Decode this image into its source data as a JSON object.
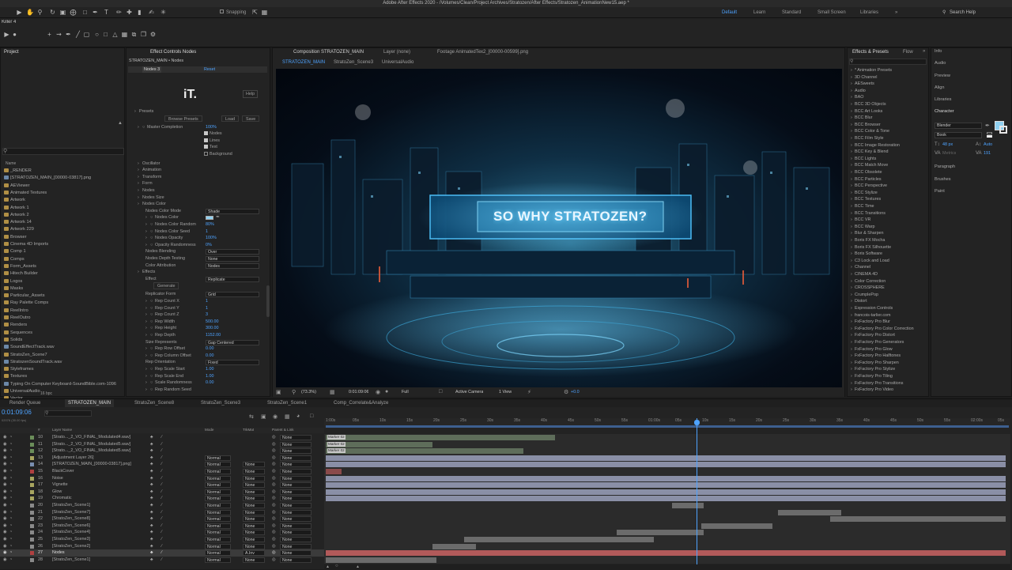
{
  "app": {
    "title": "Adobe After Effects 2020 - /Volumes/Clean/Project Archives/Stratozen/After Effects/Stratozen_AnimationNew15.aep *"
  },
  "toolbar": {
    "snapping_label": "Snapping",
    "workspaces": [
      "Default",
      "Learn",
      "Standard",
      "Small Screen",
      "Libraries"
    ],
    "active_workspace": "Default",
    "search_placeholder": "Search Help",
    "tool_preset": "Killer 4"
  },
  "project": {
    "title": "Project",
    "column_name": "Name",
    "items": [
      "_RENDER",
      "[STRATOZEN_MAIN_[00000-03817].png",
      "AEViewer",
      "Animated Textures",
      "Artwork",
      "Artwork 1",
      "Artwork 2",
      "Artwork 14",
      "Artwork 229",
      "Browser",
      "Cinema 4D Imports",
      "Comp 1",
      "Comps",
      "Form_Assets",
      "Hitech Builder",
      "Logos",
      "Masks",
      "Particular_Assets",
      "Ray Palette Comps",
      "ReelIntro",
      "ReelOutro",
      "Renders",
      "Sequences",
      "Solids",
      "SoundEffectTrack.wav",
      "StratoZen_Scene7",
      "StratozenSoundTrack.wav",
      "Styleframes",
      "Textures",
      "Typing On Computer Keyboard-SoundBible.com-1096",
      "UniversalAudio",
      "Vector",
      "VoiceOver",
      "Stratozen..._2_VO_FINAL_Modulated5.wav",
      "WorldMap.obj"
    ],
    "footer_bpc": "16 bpc"
  },
  "effect_controls": {
    "tab_label": "Effect Controls Nodes",
    "subtitle": "STRATOZEN_MAIN • Nodes",
    "effect_name": "Nodes 3",
    "reset_label": "Reset",
    "logo_text": "iT.",
    "help_label": "Help",
    "presets_label": "Presets",
    "browse_presets": "Browse Presets",
    "load_label": "Load",
    "save_label": "Save",
    "master_completion_label": "Master Completion",
    "master_completion_value": "100%",
    "checkboxes": [
      "Nodes",
      "Lines",
      "Text",
      "Background"
    ],
    "groups": [
      "Oscillator",
      "Animation",
      "Transform",
      "Form",
      "Nodes",
      "Nodes Size",
      "Nodes Color"
    ],
    "nodes_color_props": [
      {
        "label": "Nodes Color Mode",
        "value": "Shade",
        "dropdown": true
      },
      {
        "label": "Nodes Color",
        "value": "",
        "dropdown": false
      },
      {
        "label": "Nodes Color Random",
        "value": "80%",
        "dropdown": false
      },
      {
        "label": "Nodes Color Seed",
        "value": "1",
        "dropdown": false
      },
      {
        "label": "Nodes Opacity",
        "value": "100%",
        "dropdown": false
      },
      {
        "label": "Opacity Randomness",
        "value": "0%",
        "dropdown": false
      },
      {
        "label": "Nodes Blending",
        "value": "Over",
        "dropdown": true
      },
      {
        "label": "Nodes Depth Testing",
        "value": "None",
        "dropdown": true
      },
      {
        "label": "Color Attribution",
        "value": "Nodes",
        "dropdown": true
      }
    ],
    "effects_label": "Effects",
    "effect_label": "Effect",
    "effect_value": "Replicate",
    "generate_label": "Generate",
    "replicator_props": [
      {
        "label": "Replicator Form",
        "value": "Grid",
        "dropdown": true
      },
      {
        "label": "Rep Count X",
        "value": "1",
        "dropdown": false
      },
      {
        "label": "Rep Count Y",
        "value": "1",
        "dropdown": false
      },
      {
        "label": "Rep Count Z",
        "value": "3",
        "dropdown": false
      },
      {
        "label": "Rep Width",
        "value": "500.00",
        "dropdown": false
      },
      {
        "label": "Rep Height",
        "value": "300.00",
        "dropdown": false
      },
      {
        "label": "Rep Depth",
        "value": "1152.00",
        "dropdown": false
      },
      {
        "label": "Size Represents",
        "value": "Gap Centered",
        "dropdown": true
      },
      {
        "label": "Rep Row Offset",
        "value": "0.00",
        "dropdown": false
      },
      {
        "label": "Rep Column Offset",
        "value": "0.00",
        "dropdown": false
      },
      {
        "label": "Rep Orientation",
        "value": "Fixed",
        "dropdown": true
      },
      {
        "label": "Rep Scale Start",
        "value": "1.00",
        "dropdown": false
      },
      {
        "label": "Rep Scale End",
        "value": "1.00",
        "dropdown": false
      },
      {
        "label": "Scale Randomness",
        "value": "0.00",
        "dropdown": false
      },
      {
        "label": "Rep Random Seed",
        "value": "",
        "dropdown": false
      }
    ]
  },
  "viewer": {
    "tabs": [
      "Composition STRATOZEN_MAIN",
      "Layer (none)",
      "Footage AnimatedTex2_[00000-00599].png"
    ],
    "subtabs": [
      "STRATOZEN_MAIN",
      "StratoZen_Scene3",
      "UniversalAudio"
    ],
    "headline": "SO WHY STRATOZEN?",
    "zoom": "(73.3%)",
    "timecode": "0:01:09:06",
    "quality": "Full",
    "camera": "Active Camera",
    "views": "1 View",
    "exposure": "+0.0"
  },
  "effects_presets": {
    "title": "Effects & Presets",
    "flow_tab": "Flow",
    "items": [
      "* Animation Presets",
      "3D Channel",
      "AESweets",
      "Audio",
      "BAO",
      "BCC 3D Objects",
      "BCC Art Looks",
      "BCC Blur",
      "BCC Browser",
      "BCC Color & Tone",
      "BCC Film Style",
      "BCC Image Restoration",
      "BCC Key & Blend",
      "BCC Lights",
      "BCC Match Move",
      "BCC Obsolete",
      "BCC Particles",
      "BCC Perspective",
      "BCC Stylize",
      "BCC Textures",
      "BCC Time",
      "BCC Transitions",
      "BCC VR",
      "BCC Warp",
      "Blur & Sharpen",
      "Boris FX Mocha",
      "Boris FX Silhouette",
      "Boris Software",
      "C3 Lock and Load",
      "Channel",
      "CINEMA 4D",
      "Color Correction",
      "CROSSPHERE",
      "CrumplePop",
      "Distort",
      "Expression Controls",
      "francois-tarlier.com",
      "FxFactory Pro Blur",
      "FxFactory Pro Color Correction",
      "FxFactory Pro Distort",
      "FxFactory Pro Generators",
      "FxFactory Pro Glow",
      "FxFactory Pro Halftones",
      "FxFactory Pro Sharpen",
      "FxFactory Pro Stylize",
      "FxFactory Pro Tiling",
      "FxFactory Pro Transitions",
      "FxFactory Pro Video"
    ]
  },
  "right_panels": {
    "items": [
      "Info",
      "Audio",
      "Preview",
      "Align",
      "Libraries",
      "Character"
    ],
    "character": {
      "font": "Blender",
      "style": "Book",
      "size": "48 px",
      "leading": "Auto",
      "kerning": "Metrics",
      "tracking": "191"
    },
    "lower_items": [
      "Paragraph",
      "Brushes",
      "Paint"
    ]
  },
  "timeline": {
    "tabs": [
      "Render Queue",
      "STRATOZEN_MAIN",
      "StratoZen_Scene8",
      "StratoZen_Scene3",
      "StratoZen_Scene1",
      "Comp_Correlate&Analyze"
    ],
    "active_tab": "STRATOZEN_MAIN",
    "timecode": "0:01:09:06",
    "frame_info": "02076 (30.00 fps)",
    "columns": [
      "#",
      "Layer Name",
      "Mode",
      "TrkMat",
      "Parent & Link"
    ],
    "ruler": [
      "1:00s",
      "05s",
      "10s",
      "15s",
      "20s",
      "25s",
      "30s",
      "35s",
      "40s",
      "45s",
      "50s",
      "55s",
      "01:00s",
      "05s",
      "10s",
      "15s",
      "20s",
      "25s",
      "30s",
      "35s",
      "40s",
      "45s",
      "50s",
      "55s",
      "02:00s",
      "05s"
    ],
    "markers": [
      "Marker 02",
      "Marker 02",
      "Marker 02"
    ],
    "layers": [
      {
        "num": "10",
        "name": "[Strato..._2_VO_FINAL_Modulated4.wav]",
        "mode": "",
        "trk": "",
        "parent": "None",
        "color": "#6b8e5a"
      },
      {
        "num": "11",
        "name": "[Strato..._2_VO_FINAL_Modulated5.wav]",
        "mode": "",
        "trk": "",
        "parent": "None",
        "color": "#6b8e5a"
      },
      {
        "num": "12",
        "name": "[Strato..._2_VO_FINAL_Modulated5.wav]",
        "mode": "",
        "trk": "",
        "parent": "None",
        "color": "#6b8e5a"
      },
      {
        "num": "13",
        "name": "[Adjustment Layer 26]",
        "mode": "Normal",
        "trk": "",
        "parent": "None",
        "color": "#a8a560"
      },
      {
        "num": "14",
        "name": "[STRATOZEN_MAIN_[00000-03817].png]",
        "mode": "Normal",
        "trk": "None",
        "parent": "None",
        "color": "#7a8fb0"
      },
      {
        "num": "15",
        "name": "BlackCover",
        "mode": "Normal",
        "trk": "None",
        "parent": "None",
        "color": "#b04040"
      },
      {
        "num": "16",
        "name": "Noise",
        "mode": "Normal",
        "trk": "None",
        "parent": "None",
        "color": "#a8a560"
      },
      {
        "num": "17",
        "name": "Vignette",
        "mode": "Normal",
        "trk": "None",
        "parent": "None",
        "color": "#a8a560"
      },
      {
        "num": "18",
        "name": "Glow",
        "mode": "Normal",
        "trk": "None",
        "parent": "None",
        "color": "#a8a560"
      },
      {
        "num": "19",
        "name": "Chromatic",
        "mode": "Normal",
        "trk": "None",
        "parent": "None",
        "color": "#a8a560"
      },
      {
        "num": "20",
        "name": "[StratoZen_Scene1]",
        "mode": "Normal",
        "trk": "None",
        "parent": "None",
        "color": "#8a8a8a"
      },
      {
        "num": "21",
        "name": "[StratoZen_Scene7]",
        "mode": "Normal",
        "trk": "None",
        "parent": "None",
        "color": "#8a8a8a"
      },
      {
        "num": "22",
        "name": "[StratoZen_Scene8]",
        "mode": "Normal",
        "trk": "None",
        "parent": "None",
        "color": "#8a8a8a"
      },
      {
        "num": "23",
        "name": "[StratoZen_Scene6]",
        "mode": "Normal",
        "trk": "None",
        "parent": "None",
        "color": "#8a8a8a"
      },
      {
        "num": "24",
        "name": "[StratoZen_Scene4]",
        "mode": "Normal",
        "trk": "None",
        "parent": "None",
        "color": "#8a8a8a"
      },
      {
        "num": "25",
        "name": "[StratoZen_Scene3]",
        "mode": "Normal",
        "trk": "None",
        "parent": "None",
        "color": "#8a8a8a"
      },
      {
        "num": "26",
        "name": "[StratoZen_Scene2]",
        "mode": "Normal",
        "trk": "None",
        "parent": "None",
        "color": "#8a8a8a"
      },
      {
        "num": "27",
        "name": "Nodes",
        "mode": "Normal",
        "trk": "A.Inv",
        "parent": "None",
        "color": "#b04040"
      },
      {
        "num": "28",
        "name": "[StratoZen_Scene1]",
        "mode": "Normal",
        "trk": "None",
        "parent": "None",
        "color": "#8a8a8a"
      }
    ]
  }
}
